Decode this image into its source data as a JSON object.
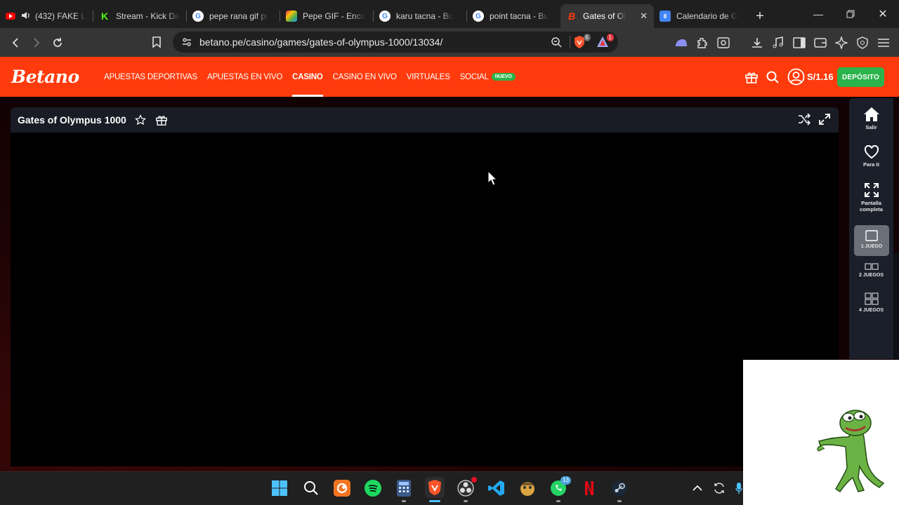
{
  "browser": {
    "tabs": [
      {
        "title": "(432) FAKE L",
        "favicon": "youtube-icon",
        "audio": true,
        "color": "#ff0000"
      },
      {
        "title": "Stream - Kick Da",
        "favicon": "kick-icon",
        "color": "#53fc18"
      },
      {
        "title": "pepe rana gif pr",
        "favicon": "google-icon",
        "color": "#ffffff"
      },
      {
        "title": "Pepe GIF - Enco",
        "favicon": "tenor-icon",
        "color": "#8bc34a"
      },
      {
        "title": "karu tacna - Bu",
        "favicon": "google-icon",
        "color": "#ffffff"
      },
      {
        "title": "point tacna - Bu",
        "favicon": "google-icon",
        "color": "#ffffff"
      },
      {
        "title": "Gates of Ol",
        "favicon": "betano-icon",
        "active": true,
        "color": "#ff3b0d"
      },
      {
        "title": "Calendario de G",
        "favicon": "calendar-icon",
        "color": "#4285f4"
      }
    ],
    "url": "betano.pe/casino/games/gates-of-olympus-1000/13034/",
    "shield_count": "6",
    "rewards_count": "1"
  },
  "site": {
    "logo": "Betano",
    "nav": [
      {
        "label": "APUESTAS DEPORTIVAS"
      },
      {
        "label": "APUESTAS EN VIVO"
      },
      {
        "label": "CASINO",
        "active": true
      },
      {
        "label": "CASINO EN VIVO"
      },
      {
        "label": "VIRTUALES"
      },
      {
        "label": "SOCIAL",
        "badge": "NUEVO"
      }
    ],
    "balance": "S/1.16",
    "deposit_label": "DEPÓSITO",
    "accent": "#ff3b0d",
    "green": "#2bb34b"
  },
  "game": {
    "title": "Gates of Olympus 1000"
  },
  "rail": {
    "items": [
      {
        "label": "Salir",
        "icon": "home-icon"
      },
      {
        "label": "Para ti",
        "icon": "heart-icon"
      },
      {
        "label": "Pantalla completa",
        "icon": "expand-icon"
      },
      {
        "label": "1 JUEGO",
        "icon": "single-layout-icon",
        "selected": true
      },
      {
        "label": "2 JUEGOS",
        "icon": "double-layout-icon"
      },
      {
        "label": "4 JUEGOS",
        "icon": "quad-layout-icon"
      }
    ]
  },
  "taskbar": {
    "apps": [
      "windows-start-icon",
      "search-icon",
      "crunchyroll-icon",
      "spotify-icon",
      "calculator-icon",
      "brave-icon",
      "obs-icon",
      "vscode-icon",
      "game-icon",
      "whatsapp-icon",
      "netflix-icon",
      "steam-icon"
    ],
    "whatsapp_badge": "13"
  }
}
